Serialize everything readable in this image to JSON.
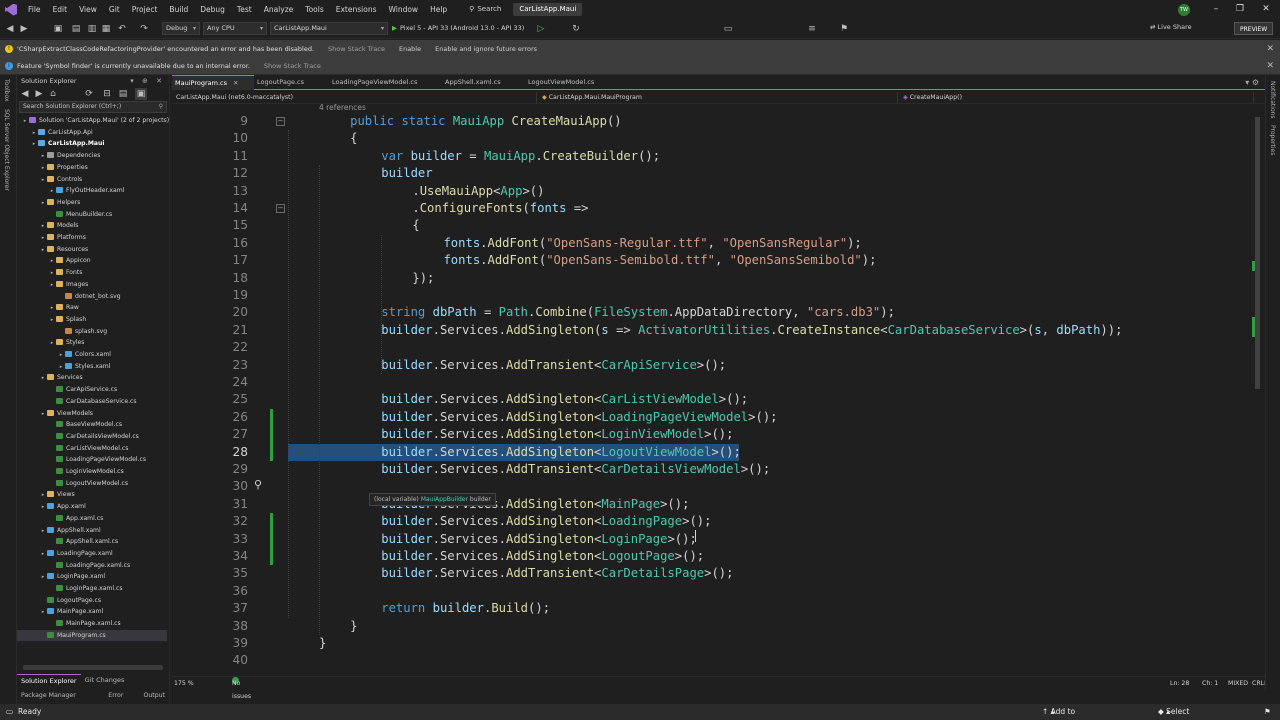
{
  "menu": {
    "items": [
      "File",
      "Edit",
      "View",
      "Git",
      "Project",
      "Build",
      "Debug",
      "Test",
      "Analyze",
      "Tools",
      "Extensions",
      "Window",
      "Help"
    ],
    "search_label": "Search",
    "title": "CarListApp.Maui",
    "avatar_initials": "TW"
  },
  "toolbar": {
    "config": "Debug",
    "platform": "Any CPU",
    "startup_project": "CarListApp.Maui",
    "run_target": "Pixel 5 - API 33 (Android 13.0 - API 33)",
    "live_share": "Live Share",
    "preview": "PREVIEW"
  },
  "infobars": [
    {
      "message": "'CSharpExtractClassCodeRefactoringProvider' encountered an error and has been disabled.",
      "actions": [
        "Show Stack Trace",
        "Enable",
        "Enable and ignore future errors"
      ],
      "icon_color": "#f0c419"
    },
    {
      "message": "Feature 'Symbol finder' is currently unavailable due to an internal error.",
      "actions": [
        "Show Stack Trace"
      ],
      "icon_color": "#3b9ce8"
    }
  ],
  "left_strip": [
    "Toolbox",
    "SQL Server Object Explorer"
  ],
  "right_strip": [
    "Notifications",
    "Properties"
  ],
  "solution_explorer": {
    "title": "Solution Explorer",
    "search_placeholder": "Search Solution Explorer (Ctrl+;)",
    "tree": [
      {
        "label": "Solution 'CarListApp.Maui' (2 of 2 projects)",
        "indent": 0,
        "kind": "solution"
      },
      {
        "label": "CarListApp.Api",
        "indent": 1,
        "kind": "project"
      },
      {
        "label": "CarListApp.Maui",
        "indent": 1,
        "kind": "project",
        "strong": true
      },
      {
        "label": "Dependencies",
        "indent": 2,
        "kind": "deps"
      },
      {
        "label": "Properties",
        "indent": 2,
        "kind": "folder"
      },
      {
        "label": "Controls",
        "indent": 2,
        "kind": "folder"
      },
      {
        "label": "FlyOutHeader.xaml",
        "indent": 3,
        "kind": "xaml"
      },
      {
        "label": "Helpers",
        "indent": 2,
        "kind": "folder"
      },
      {
        "label": "MenuBuilder.cs",
        "indent": 3,
        "kind": "cs"
      },
      {
        "label": "Models",
        "indent": 2,
        "kind": "folder"
      },
      {
        "label": "Platforms",
        "indent": 2,
        "kind": "folder"
      },
      {
        "label": "Resources",
        "indent": 2,
        "kind": "folder"
      },
      {
        "label": "AppIcon",
        "indent": 3,
        "kind": "folder"
      },
      {
        "label": "Fonts",
        "indent": 3,
        "kind": "folder"
      },
      {
        "label": "Images",
        "indent": 3,
        "kind": "folder"
      },
      {
        "label": "dotnet_bot.svg",
        "indent": 4,
        "kind": "svg"
      },
      {
        "label": "Raw",
        "indent": 3,
        "kind": "folder"
      },
      {
        "label": "Splash",
        "indent": 3,
        "kind": "folder"
      },
      {
        "label": "splash.svg",
        "indent": 4,
        "kind": "svg"
      },
      {
        "label": "Styles",
        "indent": 3,
        "kind": "folder"
      },
      {
        "label": "Colors.xaml",
        "indent": 4,
        "kind": "xaml"
      },
      {
        "label": "Styles.xaml",
        "indent": 4,
        "kind": "xaml"
      },
      {
        "label": "Services",
        "indent": 2,
        "kind": "folder"
      },
      {
        "label": "CarApiService.cs",
        "indent": 3,
        "kind": "cs"
      },
      {
        "label": "CarDatabaseService.cs",
        "indent": 3,
        "kind": "cs"
      },
      {
        "label": "ViewModels",
        "indent": 2,
        "kind": "folder"
      },
      {
        "label": "BaseViewModel.cs",
        "indent": 3,
        "kind": "cs"
      },
      {
        "label": "CarDetailsViewModel.cs",
        "indent": 3,
        "kind": "cs"
      },
      {
        "label": "CarListViewModel.cs",
        "indent": 3,
        "kind": "cs"
      },
      {
        "label": "LoadingPageViewModel.cs",
        "indent": 3,
        "kind": "cs"
      },
      {
        "label": "LoginViewModel.cs",
        "indent": 3,
        "kind": "cs"
      },
      {
        "label": "LogoutViewModel.cs",
        "indent": 3,
        "kind": "cs"
      },
      {
        "label": "Views",
        "indent": 2,
        "kind": "folder"
      },
      {
        "label": "App.xaml",
        "indent": 2,
        "kind": "xaml"
      },
      {
        "label": "App.xaml.cs",
        "indent": 3,
        "kind": "cs"
      },
      {
        "label": "AppShell.xaml",
        "indent": 2,
        "kind": "xaml"
      },
      {
        "label": "AppShell.xaml.cs",
        "indent": 3,
        "kind": "cs"
      },
      {
        "label": "LoadingPage.xaml",
        "indent": 2,
        "kind": "xaml"
      },
      {
        "label": "LoadingPage.xaml.cs",
        "indent": 3,
        "kind": "cs"
      },
      {
        "label": "LoginPage.xaml",
        "indent": 2,
        "kind": "xaml"
      },
      {
        "label": "LoginPage.xaml.cs",
        "indent": 3,
        "kind": "cs"
      },
      {
        "label": "LogoutPage.cs",
        "indent": 2,
        "kind": "cs"
      },
      {
        "label": "MainPage.xaml",
        "indent": 2,
        "kind": "xaml"
      },
      {
        "label": "MainPage.xaml.cs",
        "indent": 3,
        "kind": "cs"
      },
      {
        "label": "MauiProgram.cs",
        "indent": 2,
        "kind": "cs",
        "selected": true
      }
    ],
    "bottom_tabs": [
      "Solution Explorer",
      "Git Changes"
    ],
    "sub_tabs": [
      "Package Manager Console",
      "Error List",
      "Output"
    ]
  },
  "editor": {
    "tabs": [
      {
        "label": "MauiProgram.cs",
        "active": true
      },
      {
        "label": "LogoutPage.cs"
      },
      {
        "label": "LoadingPageViewModel.cs"
      },
      {
        "label": "AppShell.xaml.cs"
      },
      {
        "label": "LogoutViewModel.cs"
      }
    ],
    "nav_project": "CarListApp.Maui (net6.0-maccatalyst)",
    "nav_class": "CarListApp.Maui.MauiProgram",
    "nav_member": "CreateMauiApp()",
    "references": "4 references",
    "tooltip_prefix": "(local variable)",
    "tooltip_type": "MauiAppBuilder",
    "tooltip_name": "builder",
    "lines": [
      {
        "n": 9,
        "indent": 4,
        "t": [
          [
            "kw",
            "public static "
          ],
          [
            "ty",
            "MauiApp "
          ],
          [
            "fn",
            "CreateMauiApp"
          ],
          [
            "p",
            "()"
          ]
        ],
        "fold": true
      },
      {
        "n": 10,
        "indent": 4,
        "t": [
          [
            "p",
            "{"
          ]
        ]
      },
      {
        "n": 11,
        "indent": 8,
        "t": [
          [
            "kw",
            "var "
          ],
          [
            "pm",
            "builder"
          ],
          [
            "p",
            " = "
          ],
          [
            "ty",
            "MauiApp"
          ],
          [
            "p",
            "."
          ],
          [
            "fn",
            "CreateBuilder"
          ],
          [
            "p",
            "();"
          ]
        ]
      },
      {
        "n": 12,
        "indent": 8,
        "t": [
          [
            "pm",
            "builder"
          ]
        ]
      },
      {
        "n": 13,
        "indent": 12,
        "t": [
          [
            "p",
            "."
          ],
          [
            "fn",
            "UseMauiApp"
          ],
          [
            "p",
            "<"
          ],
          [
            "ty",
            "App"
          ],
          [
            "p",
            ">()"
          ]
        ]
      },
      {
        "n": 14,
        "indent": 12,
        "t": [
          [
            "p",
            "."
          ],
          [
            "fn",
            "ConfigureFonts"
          ],
          [
            "p",
            "("
          ],
          [
            "pm",
            "fonts"
          ],
          [
            "p",
            " =>"
          ]
        ],
        "fold": true
      },
      {
        "n": 15,
        "indent": 12,
        "t": [
          [
            "p",
            "{"
          ]
        ]
      },
      {
        "n": 16,
        "indent": 16,
        "t": [
          [
            "pm",
            "fonts"
          ],
          [
            "p",
            "."
          ],
          [
            "fn",
            "AddFont"
          ],
          [
            "p",
            "("
          ],
          [
            "st",
            "\"OpenSans-Regular.ttf\""
          ],
          [
            "p",
            ", "
          ],
          [
            "st",
            "\"OpenSansRegular\""
          ],
          [
            "p",
            ");"
          ]
        ]
      },
      {
        "n": 17,
        "indent": 16,
        "t": [
          [
            "pm",
            "fonts"
          ],
          [
            "p",
            "."
          ],
          [
            "fn",
            "AddFont"
          ],
          [
            "p",
            "("
          ],
          [
            "st",
            "\"OpenSans-Semibold.ttf\""
          ],
          [
            "p",
            ", "
          ],
          [
            "st",
            "\"OpenSansSemibold\""
          ],
          [
            "p",
            ");"
          ]
        ]
      },
      {
        "n": 18,
        "indent": 12,
        "t": [
          [
            "p",
            "});"
          ]
        ]
      },
      {
        "n": 19,
        "indent": 0,
        "t": []
      },
      {
        "n": 20,
        "indent": 8,
        "t": [
          [
            "kw",
            "string "
          ],
          [
            "pm",
            "dbPath"
          ],
          [
            "p",
            " = "
          ],
          [
            "ty",
            "Path"
          ],
          [
            "p",
            "."
          ],
          [
            "fn",
            "Combine"
          ],
          [
            "p",
            "("
          ],
          [
            "ty",
            "FileSystem"
          ],
          [
            "p",
            ".AppDataDirectory, "
          ],
          [
            "st",
            "\"cars.db3\""
          ],
          [
            "p",
            ");"
          ]
        ]
      },
      {
        "n": 21,
        "indent": 8,
        "t": [
          [
            "pm",
            "builder"
          ],
          [
            "p",
            ".Services."
          ],
          [
            "fn",
            "AddSingleton"
          ],
          [
            "p",
            "("
          ],
          [
            "pm",
            "s"
          ],
          [
            "p",
            " => "
          ],
          [
            "ty",
            "ActivatorUtilities"
          ],
          [
            "p",
            "."
          ],
          [
            "fn",
            "CreateInstance"
          ],
          [
            "p",
            "<"
          ],
          [
            "ty",
            "CarDatabaseService"
          ],
          [
            "p",
            ">("
          ],
          [
            "pm",
            "s"
          ],
          [
            "p",
            ", "
          ],
          [
            "pm",
            "dbPath"
          ],
          [
            "p",
            "));"
          ]
        ]
      },
      {
        "n": 22,
        "indent": 0,
        "t": []
      },
      {
        "n": 23,
        "indent": 8,
        "t": [
          [
            "pm",
            "builder"
          ],
          [
            "p",
            ".Services."
          ],
          [
            "fn",
            "AddTransient"
          ],
          [
            "p",
            "<"
          ],
          [
            "ty",
            "CarApiService"
          ],
          [
            "p",
            ">();"
          ]
        ]
      },
      {
        "n": 24,
        "indent": 0,
        "t": []
      },
      {
        "n": 25,
        "indent": 8,
        "t": [
          [
            "pm",
            "builder"
          ],
          [
            "p",
            ".Services."
          ],
          [
            "fn",
            "AddSingleton"
          ],
          [
            "p",
            "<"
          ],
          [
            "ty",
            "CarListViewModel"
          ],
          [
            "p",
            ">();"
          ]
        ]
      },
      {
        "n": 26,
        "indent": 8,
        "t": [
          [
            "pm",
            "builder"
          ],
          [
            "p",
            ".Services."
          ],
          [
            "fn",
            "AddSingleton"
          ],
          [
            "p",
            "<"
          ],
          [
            "ty",
            "LoadingPageViewModel"
          ],
          [
            "p",
            ">();"
          ]
        ],
        "changed": true
      },
      {
        "n": 27,
        "indent": 8,
        "t": [
          [
            "pm",
            "builder"
          ],
          [
            "p",
            ".Services."
          ],
          [
            "fn",
            "AddSingleton"
          ],
          [
            "p",
            "<"
          ],
          [
            "ty",
            "LoginViewModel"
          ],
          [
            "p",
            ">();"
          ]
        ],
        "changed": true
      },
      {
        "n": 28,
        "indent": 8,
        "t": [
          [
            "pm",
            "builder"
          ],
          [
            "p",
            ".Services."
          ],
          [
            "fn",
            "AddSingleton"
          ],
          [
            "p",
            "<"
          ],
          [
            "ty",
            "LogoutViewModel"
          ],
          [
            "p",
            ">();"
          ]
        ],
        "changed": true,
        "highlight": true,
        "current": true
      },
      {
        "n": 29,
        "indent": 8,
        "t": [
          [
            "pm",
            "builder"
          ],
          [
            "p",
            ".Services."
          ],
          [
            "fn",
            "AddTransient"
          ],
          [
            "p",
            "<"
          ],
          [
            "ty",
            "CarDetailsViewModel"
          ],
          [
            "p",
            ">();"
          ]
        ]
      },
      {
        "n": 30,
        "indent": 0,
        "t": []
      },
      {
        "n": 31,
        "indent": 8,
        "t": [
          [
            "pm",
            "builder"
          ],
          [
            "p",
            ".Services."
          ],
          [
            "fn",
            "AddSingleton"
          ],
          [
            "p",
            "<"
          ],
          [
            "ty",
            "MainPage"
          ],
          [
            "p",
            ">();"
          ]
        ]
      },
      {
        "n": 32,
        "indent": 8,
        "t": [
          [
            "pm",
            "builder"
          ],
          [
            "p",
            ".Services."
          ],
          [
            "fn",
            "AddSingleton"
          ],
          [
            "p",
            "<"
          ],
          [
            "ty",
            "LoadingPage"
          ],
          [
            "p",
            ">();"
          ]
        ],
        "changed": true
      },
      {
        "n": 33,
        "indent": 8,
        "t": [
          [
            "pm",
            "builder"
          ],
          [
            "p",
            ".Services."
          ],
          [
            "fn",
            "AddSingleton"
          ],
          [
            "p",
            "<"
          ],
          [
            "ty",
            "LoginPage"
          ],
          [
            "p",
            ">();"
          ]
        ],
        "changed": true
      },
      {
        "n": 34,
        "indent": 8,
        "t": [
          [
            "pm",
            "builder"
          ],
          [
            "p",
            ".Services."
          ],
          [
            "fn",
            "AddSingleton"
          ],
          [
            "p",
            "<"
          ],
          [
            "ty",
            "LogoutPage"
          ],
          [
            "p",
            ">();"
          ]
        ],
        "changed": true
      },
      {
        "n": 35,
        "indent": 8,
        "t": [
          [
            "pm",
            "builder"
          ],
          [
            "p",
            ".Services."
          ],
          [
            "fn",
            "AddTransient"
          ],
          [
            "p",
            "<"
          ],
          [
            "ty",
            "CarDetailsPage"
          ],
          [
            "p",
            ">();"
          ]
        ]
      },
      {
        "n": 36,
        "indent": 0,
        "t": []
      },
      {
        "n": 37,
        "indent": 8,
        "t": [
          [
            "kw",
            "return "
          ],
          [
            "pm",
            "builder"
          ],
          [
            "p",
            "."
          ],
          [
            "fn",
            "Build"
          ],
          [
            "p",
            "();"
          ]
        ]
      },
      {
        "n": 38,
        "indent": 4,
        "t": [
          [
            "p",
            "}"
          ]
        ]
      },
      {
        "n": 39,
        "indent": 0,
        "t": [
          [
            "p",
            "}"
          ]
        ]
      },
      {
        "n": 40,
        "indent": 0,
        "t": []
      }
    ]
  },
  "editor_status": {
    "zoom": "175 %",
    "issues": "No issues found",
    "line": "Ln: 28",
    "col": "Ch: 1",
    "whitespace": "MIXED",
    "line_endings": "CRLF"
  },
  "statusbar": {
    "state": "Ready",
    "source_control": "Add to Source Control",
    "repository": "Select Repository"
  }
}
